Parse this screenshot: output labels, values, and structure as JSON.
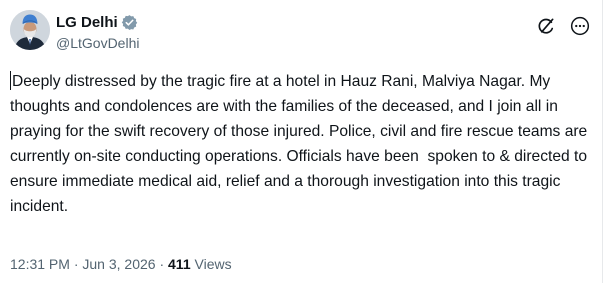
{
  "author": {
    "display_name": "LG Delhi",
    "handle": "@LtGovDelhi",
    "verified_badge_color": "#829aab",
    "avatar_icon": "profile-photo"
  },
  "actions": {
    "grok_icon": "grok-icon",
    "more_icon": "more-options-icon"
  },
  "tweet": {
    "text": "Deeply distressed by the tragic fire at a hotel in Hauz Rani, Malviya Nagar. My thoughts and condolences are with the families of the deceased, and I join all in praying for the swift recovery of those injured. Police, civil and fire rescue teams are currently on-site conducting operations. Officials have been  spoken to & directed to ensure immediate medical aid, relief and a thorough investigation into this tragic incident."
  },
  "meta": {
    "time": "12:31 PM",
    "separator": " · ",
    "date": "Jun 3, 2026",
    "views_count": "411",
    "views_label": "Views"
  },
  "colors": {
    "text_primary": "#0f1419",
    "text_secondary": "#536471"
  }
}
